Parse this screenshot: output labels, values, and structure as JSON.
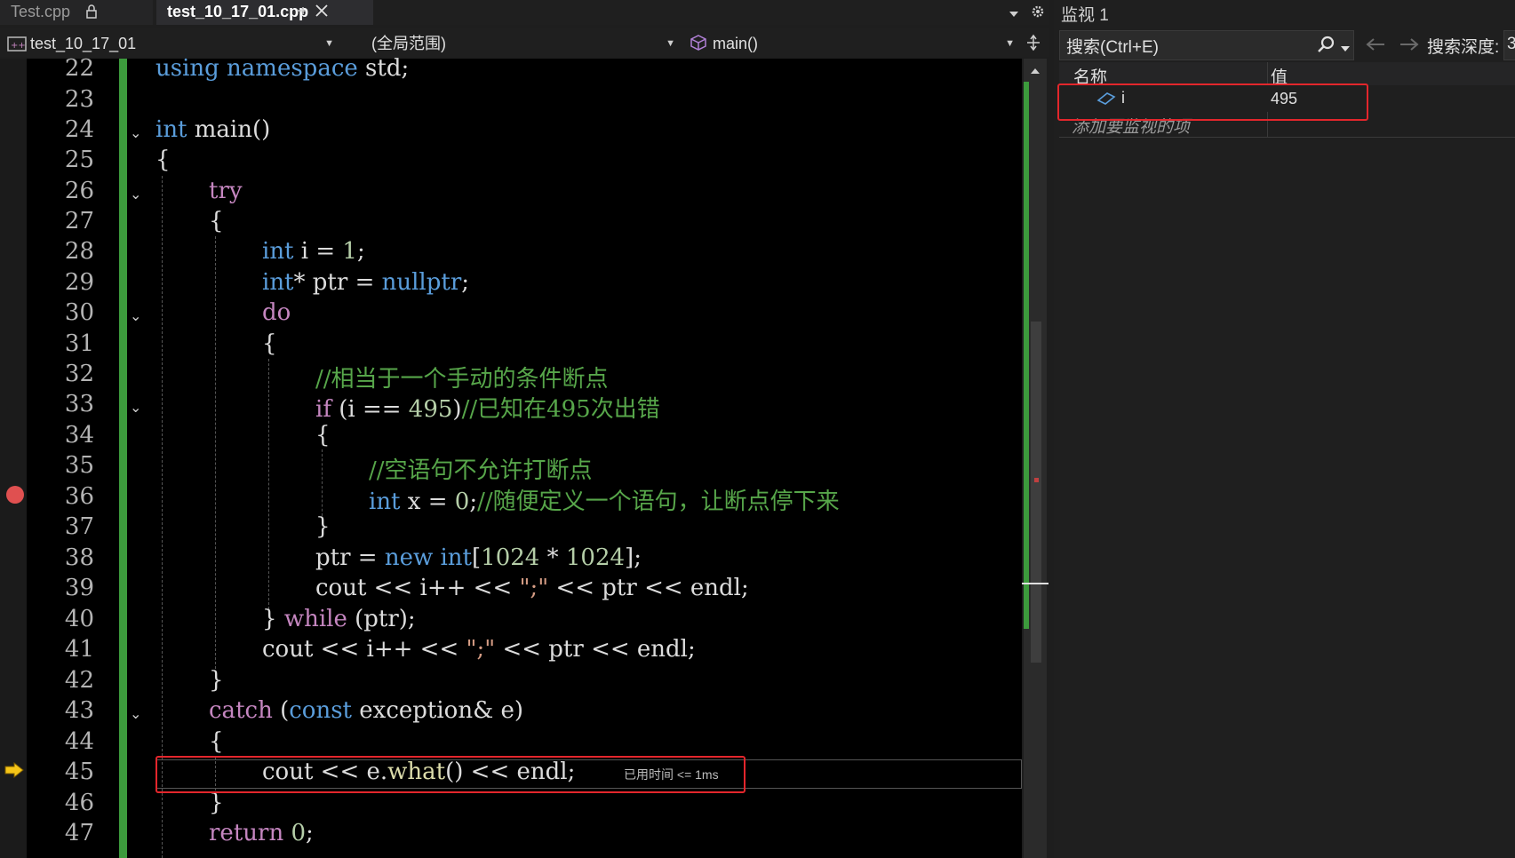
{
  "tabs": [
    {
      "label": "Test.cpp",
      "icon": "lock-icon",
      "active": false
    },
    {
      "label": "test_10_17_01.cpp",
      "icon": "pin-icon",
      "active": true
    }
  ],
  "tab_close_glyph": "✕",
  "tab_pin_glyph": "⊣",
  "tab_lock_glyph": "🔒",
  "navbar": {
    "project": "test_10_17_01",
    "scope": "(全局范围)",
    "member": "main()"
  },
  "editor": {
    "line_numbers": [
      "22",
      "23",
      "24",
      "25",
      "26",
      "27",
      "28",
      "29",
      "30",
      "31",
      "32",
      "33",
      "34",
      "35",
      "36",
      "37",
      "38",
      "39",
      "40",
      "41",
      "42",
      "43",
      "44",
      "45",
      "46",
      "47"
    ],
    "breakpoint_line": "36",
    "current_line": "45",
    "elapsed_label": "已用时间 <= 1ms",
    "code": {
      "l22_a": "using namespace",
      "l22_b": " std;",
      "l24_a": "int",
      "l24_b": " main()",
      "l25": "{",
      "l26": "try",
      "l27": "{",
      "l28_a": "int",
      "l28_b": " i = ",
      "l28_c": "1",
      "l28_d": ";",
      "l29_a": "int",
      "l29_b": "* ptr = ",
      "l29_c": "nullptr",
      "l29_d": ";",
      "l30": "do",
      "l31": "{",
      "l32": "//相当于一个手动的条件断点",
      "l33_a": "if",
      "l33_b": " (i == ",
      "l33_c": "495",
      "l33_d": ")",
      "l33_e": "//已知在495次出错",
      "l34": "{",
      "l35": "//空语句不允许打断点",
      "l36_a": "int",
      "l36_b": " x = ",
      "l36_c": "0",
      "l36_d": ";",
      "l36_e": "//随便定义一个语句，让断点停下来",
      "l37": "}",
      "l38_a": "ptr = ",
      "l38_b": "new int",
      "l38_c": "[",
      "l38_d": "1024",
      "l38_e": " * ",
      "l38_f": "1024",
      "l38_g": "];",
      "l39_a": "cout << i++ << ",
      "l39_b": "\";\"",
      "l39_c": " << ptr << endl;",
      "l40_a": "} ",
      "l40_b": "while",
      "l40_c": " (ptr);",
      "l41_a": "cout << i++ << ",
      "l41_b": "\";\"",
      "l41_c": " << ptr << endl;",
      "l42": "}",
      "l43_a": "catch",
      "l43_b": " (",
      "l43_c": "const",
      "l43_d": " exception& e)",
      "l44": "{",
      "l45_a": "cout << e.",
      "l45_b": "what",
      "l45_c": "() << endl;",
      "l46": "}",
      "l47_a": "return",
      "l47_b": " ",
      "l47_c": "0",
      "l47_d": ";"
    }
  },
  "watch": {
    "title": "监视 1",
    "search_placeholder": "搜索(Ctrl+E)",
    "search_depth_label": "搜索深度:",
    "search_depth_value": "3",
    "col_name": "名称",
    "col_value": "值",
    "rows": [
      {
        "name": "i",
        "value": "495",
        "icon": "variable-icon"
      }
    ],
    "add_item_placeholder": "添加要监视的项"
  },
  "colors": {
    "keyword": "#5a9ddb",
    "control": "#c586c0",
    "comment": "#57a64a",
    "highlight_box": "#e3262c",
    "breakpoint": "#e05050",
    "change_bar": "#3c9a3c"
  }
}
